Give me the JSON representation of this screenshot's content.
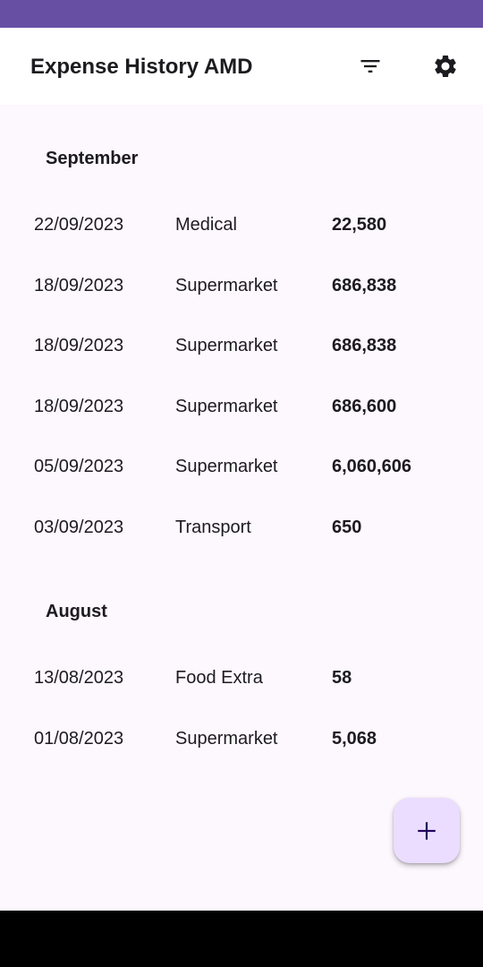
{
  "app_bar": {
    "title": "Expense History AMD",
    "filter_icon": "filter-list-icon",
    "settings_icon": "gear-icon"
  },
  "sections": [
    {
      "month": "September",
      "rows": [
        {
          "date": "22/09/2023",
          "category": "Medical",
          "amount": "22,580"
        },
        {
          "date": "18/09/2023",
          "category": "Supermarket",
          "amount": "686,838"
        },
        {
          "date": "18/09/2023",
          "category": "Supermarket",
          "amount": "686,838"
        },
        {
          "date": "18/09/2023",
          "category": "Supermarket",
          "amount": "686,600"
        },
        {
          "date": "05/09/2023",
          "category": "Supermarket",
          "amount": "6,060,606"
        },
        {
          "date": "03/09/2023",
          "category": "Transport",
          "amount": "650"
        }
      ]
    },
    {
      "month": "August",
      "rows": [
        {
          "date": "13/08/2023",
          "category": "Food Extra",
          "amount": "58"
        },
        {
          "date": "01/08/2023",
          "category": "Supermarket",
          "amount": "5,068"
        }
      ]
    }
  ],
  "fab": {
    "icon": "plus-icon"
  },
  "colors": {
    "status_bar": "#6750a4",
    "background": "#fdf7fe",
    "fab": "#eaddff",
    "text": "#1c1b1f"
  }
}
